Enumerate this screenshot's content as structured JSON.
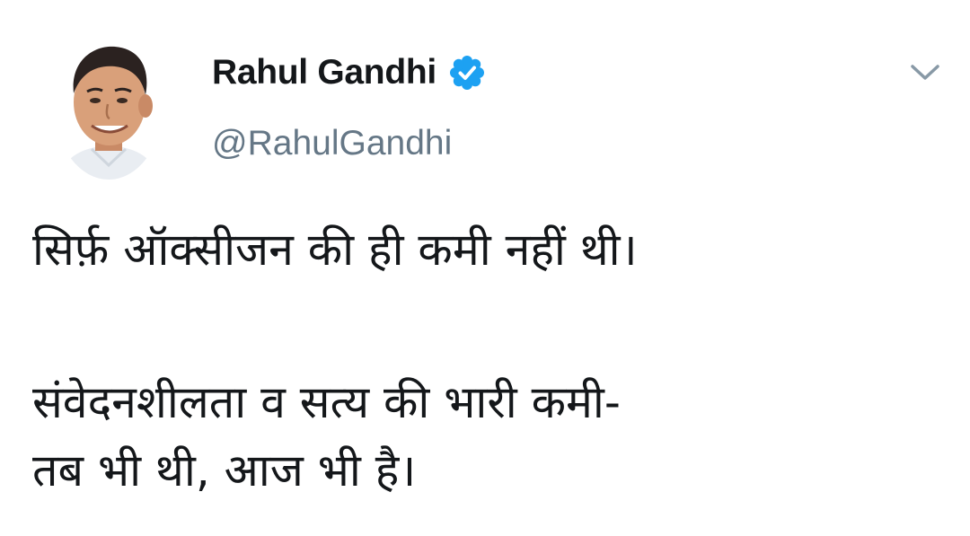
{
  "tweet": {
    "author": {
      "display_name": "Rahul Gandhi",
      "handle": "@RahulGandhi",
      "verified": true,
      "avatar": "profile-photo"
    },
    "menu_icon": "chevron-down-icon",
    "verified_icon": "verified-badge-icon",
    "body": {
      "paragraph1": "सिर्फ़ ऑक्सीजन की ही कमी नहीं थी।",
      "paragraph2_line1": "संवेदनशीलता व सत्य की भारी कमी-",
      "paragraph2_line2": "तब भी थी, आज भी है।"
    }
  },
  "colors": {
    "text": "#14171a",
    "secondary_text": "#657786",
    "verified_blue": "#1da1f2",
    "caret": "#8899a6"
  }
}
